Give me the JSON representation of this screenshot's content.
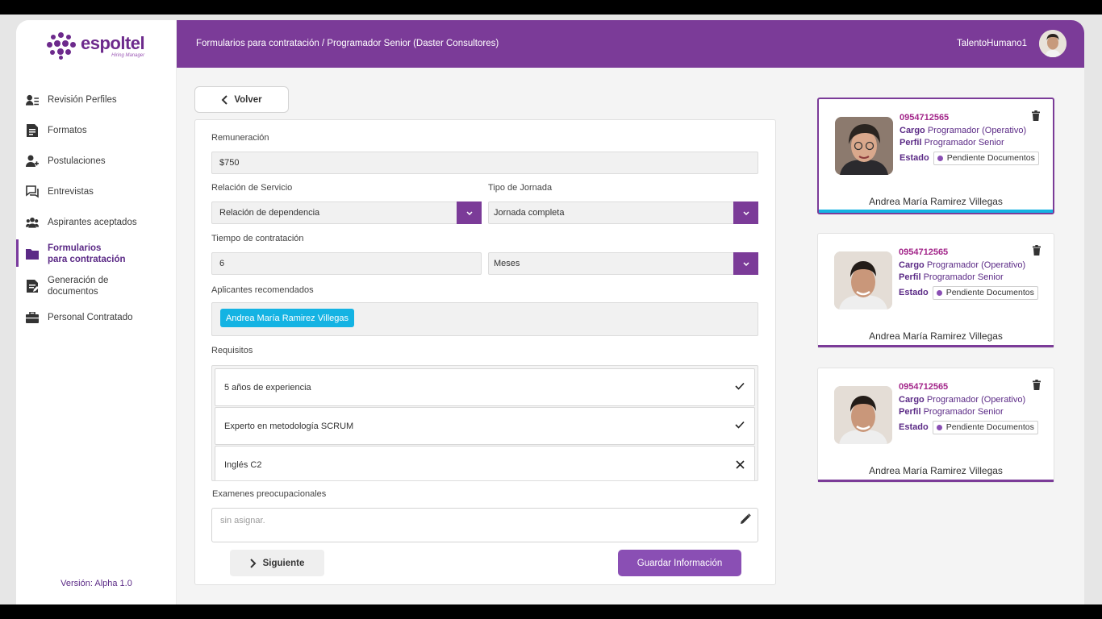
{
  "brand": {
    "name": "espoltel",
    "sub": "Hiring Manager"
  },
  "sidebar": {
    "items": [
      {
        "label": "Revisión Perfiles",
        "icon": "user-list-icon"
      },
      {
        "label": "Formatos",
        "icon": "document-icon"
      },
      {
        "label": "Postulaciones",
        "icon": "user-add-icon"
      },
      {
        "label": "Entrevistas",
        "icon": "chat-icon"
      },
      {
        "label": "Aspirantes aceptados",
        "icon": "users-group-icon"
      },
      {
        "label_line1": "Formularios",
        "label_line2": "para contratación",
        "icon": "folder-icon",
        "active": true
      },
      {
        "label_line1": "Generación de",
        "label_line2": "documentos",
        "icon": "document-edit-icon"
      },
      {
        "label": "Personal Contratado",
        "icon": "briefcase-icon"
      }
    ],
    "version": "Versión: Alpha 1.0"
  },
  "header": {
    "breadcrumb": "Formularios para contratación /  Programador Senior (Daster Consultores)",
    "user": "TalentoHumano1"
  },
  "form": {
    "back_label": "Volver",
    "remuneracion": {
      "label": "Remuneración",
      "value": "$750"
    },
    "relacion": {
      "label": "Relación de Servicio",
      "value": "Relación de dependencia"
    },
    "jornada": {
      "label": "Tipo de Jornada",
      "value": "Jornada completa"
    },
    "tiempo": {
      "label": "Tiempo de contratación",
      "value": "6",
      "unit": "Meses"
    },
    "aplicantes": {
      "label": "Aplicantes recomendados",
      "chips": [
        "Andrea María Ramirez Villegas"
      ]
    },
    "requisitos": {
      "label": "Requisitos",
      "items": [
        {
          "text": "5 años de experiencia",
          "status": "check"
        },
        {
          "text": "Experto en metodología SCRUM",
          "status": "check"
        },
        {
          "text": "Inglés C2",
          "status": "cross"
        }
      ]
    },
    "examenes": {
      "label": "Examenes preocupacionales",
      "placeholder": "sin asignar."
    },
    "next_label": "Siguiente",
    "save_label": "Guardar Información"
  },
  "candidates": [
    {
      "id": "0954712565",
      "cargo_label": "Cargo",
      "cargo": "Programador (Operativo)",
      "perfil_label": "Perfil",
      "perfil": "Programador Senior",
      "estado_label": "Estado",
      "estado": "Pendiente Documentos",
      "name": "Andrea María Ramirez Villegas",
      "selected": true,
      "photo": "woman"
    },
    {
      "id": "0954712565",
      "cargo_label": "Cargo",
      "cargo": "Programador (Operativo)",
      "perfil_label": "Perfil",
      "perfil": "Programador Senior",
      "estado_label": "Estado",
      "estado": "Pendiente Documentos",
      "name": "Andrea María Ramirez Villegas",
      "selected": false,
      "photo": "man"
    },
    {
      "id": "0954712565",
      "cargo_label": "Cargo",
      "cargo": "Programador (Operativo)",
      "perfil_label": "Perfil",
      "perfil": "Programador Senior",
      "estado_label": "Estado",
      "estado": "Pendiente Documentos",
      "name": "Andrea María Ramirez Villegas",
      "selected": false,
      "photo": "man"
    }
  ],
  "colors": {
    "primary": "#7b3b98",
    "accent": "#14b3e3",
    "button": "#8a4fb4",
    "id": "#a3268a"
  }
}
